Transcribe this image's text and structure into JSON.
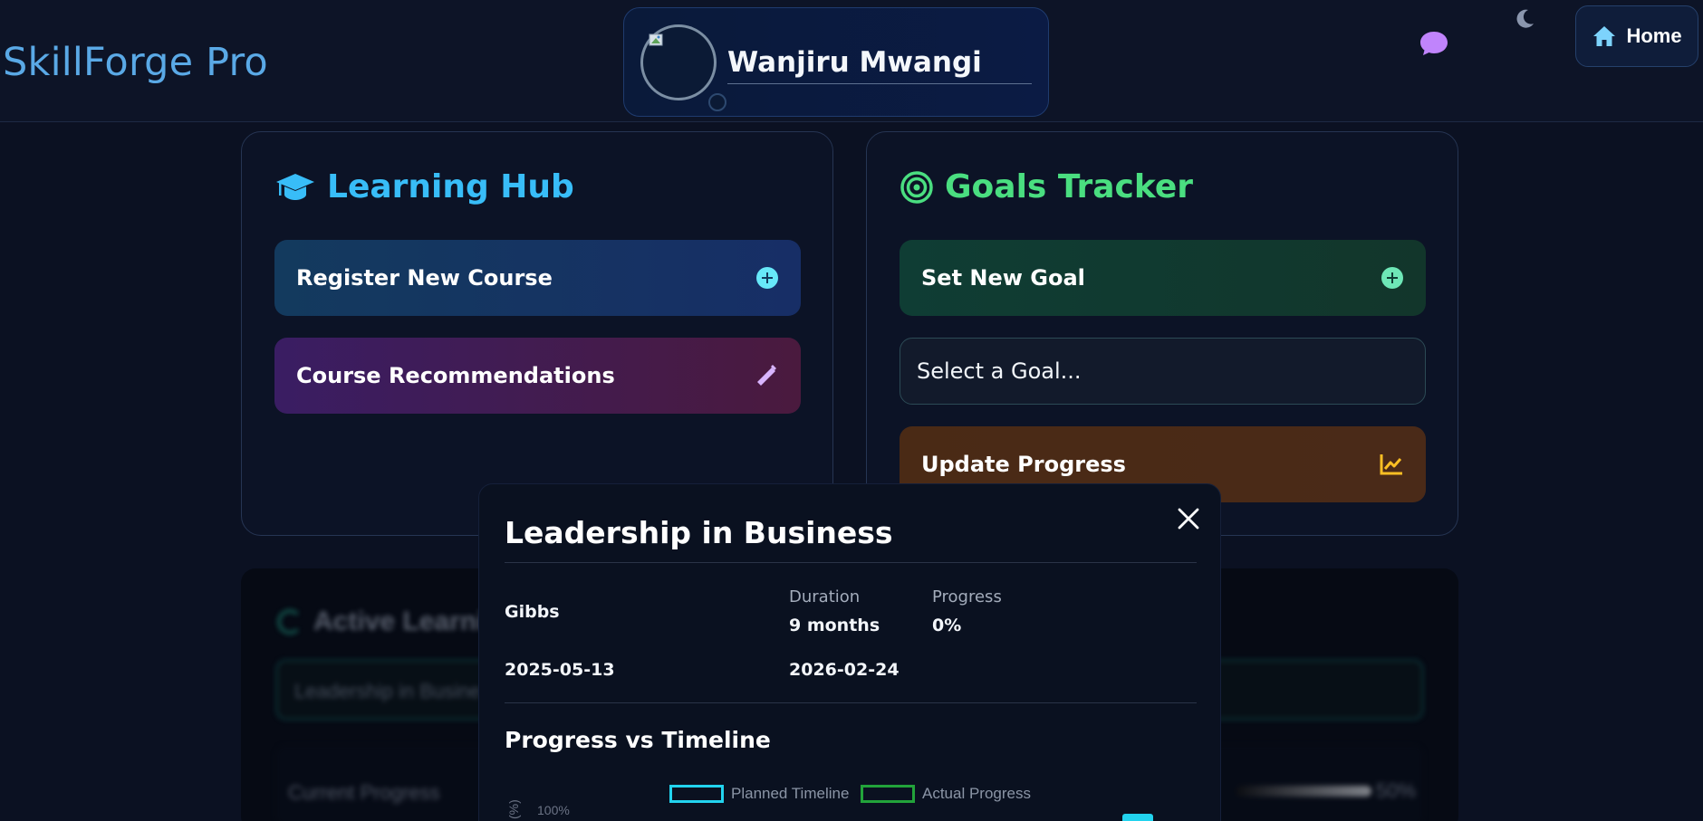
{
  "header": {
    "brand": "SkillForge Pro",
    "profile_name": "Wanjiru Mwangi",
    "home_label": "Home"
  },
  "learning_hub": {
    "title": "Learning Hub",
    "register_label": "Register New Course",
    "recommend_label": "Course Recommendations"
  },
  "goals": {
    "title": "Goals Tracker",
    "set_goal_label": "Set New Goal",
    "select_placeholder": "Select a Goal...",
    "update_label": "Update Progress"
  },
  "background": {
    "title": "Active Learni",
    "select_value": "Leadership in Busine",
    "progress_label": "Current Progress",
    "progress_pct": "50%",
    "progress_value": 0.5
  },
  "modal": {
    "title": "Leadership in Business",
    "provider": "Gibbs",
    "duration_label": "Duration",
    "duration_value": "9 months",
    "progress_label": "Progress",
    "progress_value": "0%",
    "start_date": "2025-05-13",
    "end_date": "2026-02-24",
    "section_title": "Progress vs Timeline",
    "legend_planned": "Planned Timeline",
    "legend_actual": "Actual Progress",
    "y_axis_label": "(%)",
    "y_tick_top": "100%"
  },
  "colors": {
    "planned": "#22d3ee",
    "actual": "#22a33a",
    "hub_title": "#38bdf8",
    "goals_title": "#4ade80"
  }
}
